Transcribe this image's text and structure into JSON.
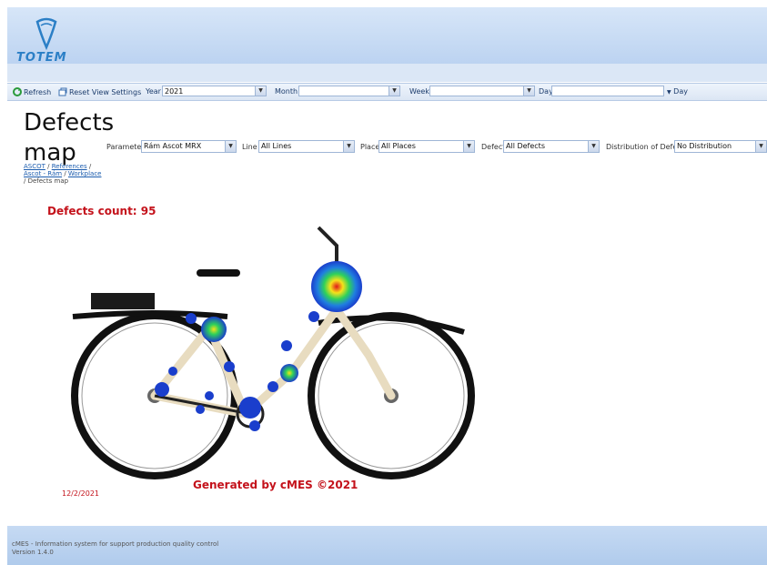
{
  "brand": {
    "logo_text": "TOTEM"
  },
  "toolbar": {
    "refresh_label": "Refresh",
    "reset_label": "Reset View Settings",
    "year_label": "Year",
    "year_value": "2021",
    "month_label": "Month",
    "month_value": "",
    "week_label": "Week",
    "week_value": "",
    "day_label": "Day",
    "day_value": "",
    "day_button": "Day"
  },
  "page": {
    "title_line1": "Defects",
    "title_line2": "map"
  },
  "filters": {
    "parameter_label": "Parameter",
    "parameter_value": "Rám Ascot MRX",
    "line_label": "Line",
    "line_value": "All Lines",
    "place_label": "Place",
    "place_value": "All Places",
    "defect_label": "Defect",
    "defect_value": "All Defects",
    "distribution_label": "Distribution of Defects",
    "distribution_value": "No Distribution"
  },
  "breadcrumb": {
    "item1": "ASCOT",
    "item2": "References",
    "item3": "Ascot - Rám",
    "item4": "Workplace",
    "current": "Defects map"
  },
  "map": {
    "defects_count": "Defects count: 95",
    "generated_by": "Generated by cMES ©2021",
    "date": "12/2/2021"
  },
  "footer": {
    "line1": "cMES - Information system for support production quality control",
    "line2": "Version 1.4.0"
  },
  "colors": {
    "accent": "#2b7fc6",
    "header_bg": "#c6daf3",
    "alert_red": "#c4121b",
    "frame_beige": "#e8dcc0"
  }
}
